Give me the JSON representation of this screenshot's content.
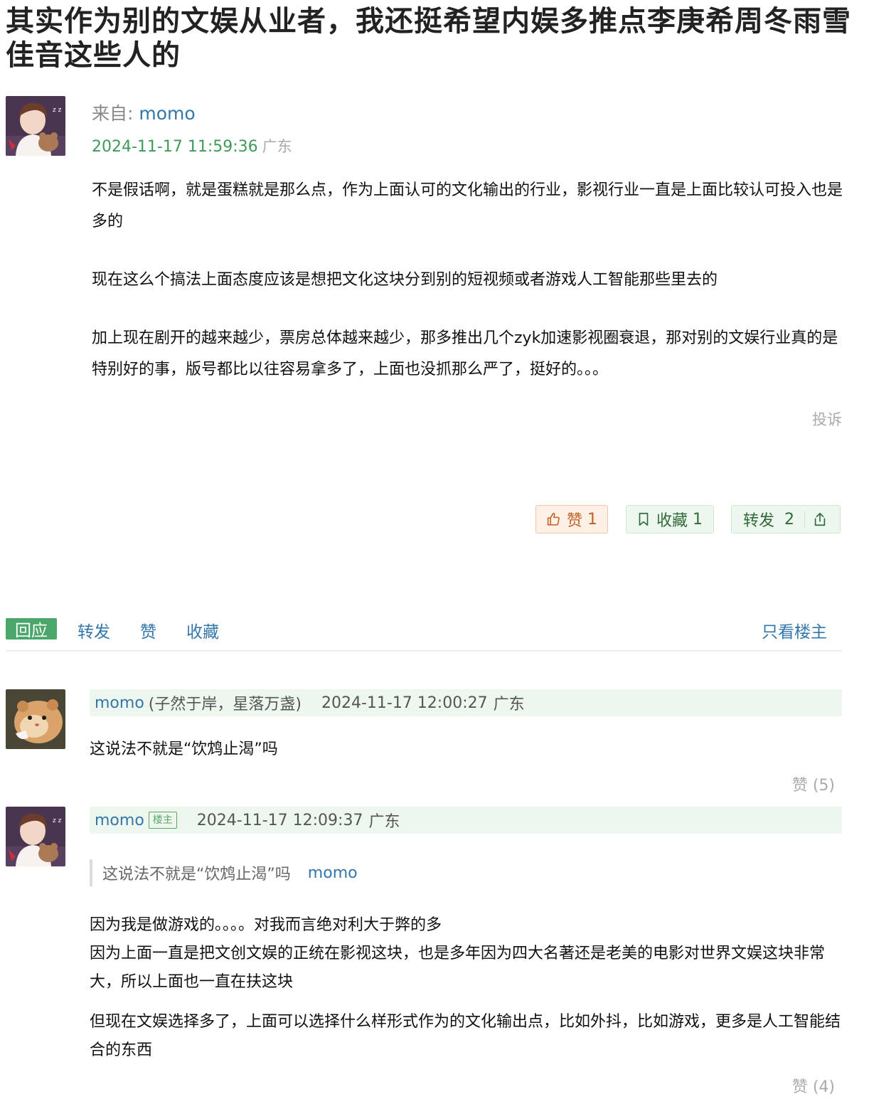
{
  "topic": {
    "title": "其实作为别的文娱从业者，我还挺希望内娱多推点李庚希周冬雨雪佳音这些人的"
  },
  "op": {
    "from_label": "来自:",
    "author": "momo",
    "time": "2024-11-17 11:59:36",
    "location": "广东",
    "paragraphs": [
      "不是假话啊，就是蛋糕就是那么点，作为上面认可的文化输出的行业，影视行业一直是上面比较认可投入也是多的",
      "现在这么个搞法上面态度应该是想把文化这块分到别的短视频或者游戏人工智能那些里去的",
      "加上现在剧开的越来越少，票房总体越来越少，那多推出几个zyk加速影视圈衰退，那对别的文娱行业真的是特别好的事，版号都比以往容易拿多了，上面也没抓那么严了，挺好的。。。"
    ],
    "report_label": "投诉",
    "actions": {
      "like_label": "赞",
      "like_count": "1",
      "fav_label": "收藏",
      "fav_count": "1",
      "forward_label": "转发",
      "forward_count": "2"
    }
  },
  "tabs": {
    "reply": "回应",
    "forward": "转发",
    "like": "赞",
    "fav": "收藏",
    "only_op": "只看楼主"
  },
  "replies": [
    {
      "author": "momo",
      "nickname": "(子然于岸，星落万盏)",
      "time": "2024-11-17 12:00:27",
      "location": "广东",
      "text": "这说法不就是“饮鸩止渴”吗",
      "like": "赞 (5)"
    },
    {
      "author": "momo",
      "badge": "楼主",
      "time": "2024-11-17 12:09:37",
      "location": "广东",
      "quote_text": "这说法不就是“饮鸩止渴”吗",
      "quote_author": "momo",
      "lines": [
        "因为我是做游戏的。。。。对我而言绝对利大于弊的多",
        "因为上面一直是把文创文娱的正统在影视这块，也是多年因为四大名著还是老美的电影对世界文娱这块非常大，所以上面也一直在扶这块",
        "但现在文娱选择多了，上面可以选择什么样形式作为的文化输出点，比如外抖，比如游戏，更多是人工智能结合的东西"
      ],
      "like": "赞 (4)"
    }
  ]
}
